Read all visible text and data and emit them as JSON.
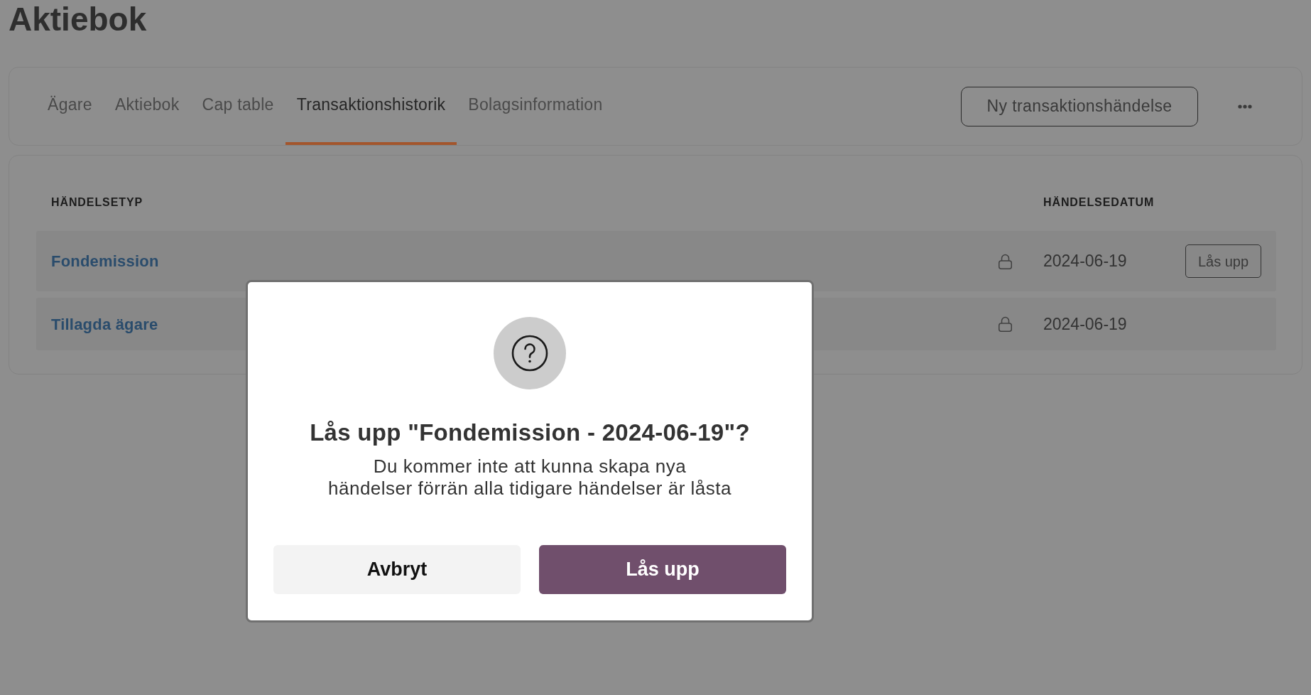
{
  "page": {
    "title": "Aktiebok"
  },
  "tabs": [
    {
      "label": "Ägare",
      "selected": false
    },
    {
      "label": "Aktiebok",
      "selected": false
    },
    {
      "label": "Cap table",
      "selected": false
    },
    {
      "label": "Transaktionshistorik",
      "selected": true
    },
    {
      "label": "Bolagsinformation",
      "selected": false
    }
  ],
  "toolbar": {
    "new_button": "Ny transaktionshändelse"
  },
  "table": {
    "columns": [
      "HÄNDELSETYP",
      "HÄNDELSEDATUM"
    ],
    "rows": [
      {
        "type": "Fondemission",
        "locked": true,
        "date": "2024-06-19",
        "action": "Lås upp"
      },
      {
        "type": "Tillagda ägare",
        "locked": true,
        "date": "2024-06-19"
      }
    ]
  },
  "dialog": {
    "title": "Lås upp \"Fondemission - 2024-06-19\"?",
    "message": "Du kommer inte att kunna skapa nya\nhändelser förrän alla tidigare händelser är låsta",
    "buttons": [
      {
        "label": "Avbryt",
        "kind": "secondary"
      },
      {
        "label": "Lås upp",
        "kind": "primary"
      }
    ]
  }
}
